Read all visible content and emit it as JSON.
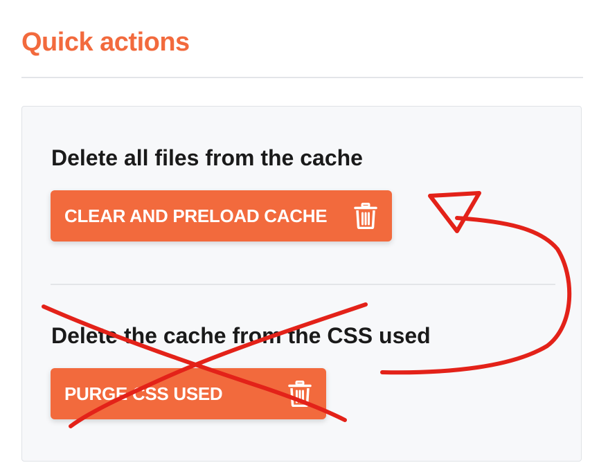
{
  "header": {
    "title": "Quick actions"
  },
  "sections": [
    {
      "heading": "Delete all files from the cache",
      "button_label": "CLEAR AND PRELOAD CACHE",
      "button_icon": "trash-icon"
    },
    {
      "heading": "Delete the cache from the CSS used",
      "button_label": "PURGE CSS USED",
      "button_icon": "trash-icon"
    }
  ],
  "colors": {
    "accent": "#f26a3d",
    "annotation": "#e32219",
    "card_background": "#f7f8fa"
  }
}
